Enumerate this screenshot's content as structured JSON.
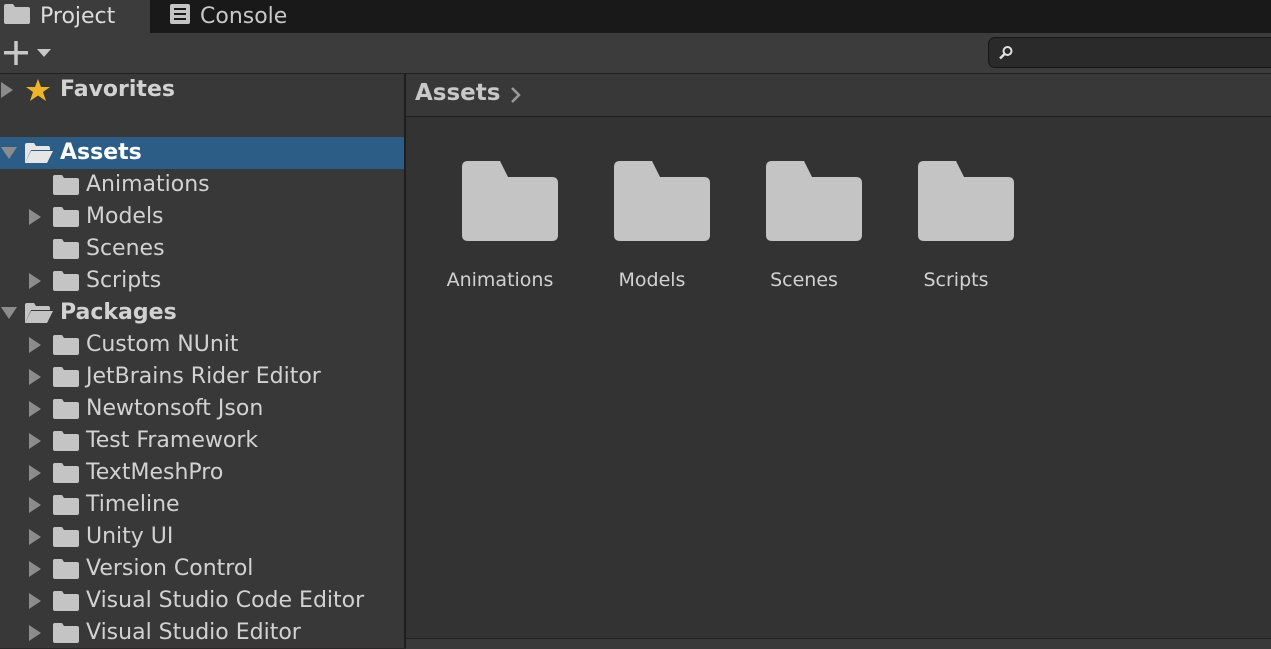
{
  "tabs": [
    {
      "label": "Project",
      "icon": "folder-icon",
      "active": true
    },
    {
      "label": "Console",
      "icon": "console-icon",
      "active": false
    }
  ],
  "toolbar": {
    "add_icon": "plus-icon",
    "search": {
      "value": "",
      "placeholder": ""
    }
  },
  "tree": {
    "favorites": {
      "label": "Favorites",
      "icon": "star-icon"
    },
    "assets": {
      "label": "Assets",
      "children": [
        "Animations",
        "Models",
        "Scenes",
        "Scripts"
      ]
    },
    "packages": {
      "label": "Packages",
      "children": [
        "Custom NUnit",
        "JetBrains Rider Editor",
        "Newtonsoft Json",
        "Test Framework",
        "TextMeshPro",
        "Timeline",
        "Unity UI",
        "Version Control",
        "Visual Studio Code Editor",
        "Visual Studio Editor"
      ]
    }
  },
  "breadcrumb": {
    "path": "Assets"
  },
  "content": {
    "items": [
      {
        "label": "Animations"
      },
      {
        "label": "Models"
      },
      {
        "label": "Scenes"
      },
      {
        "label": "Scripts"
      }
    ]
  },
  "colors": {
    "selection": "#2c5d87",
    "panel": "#383838",
    "content": "#333333",
    "folder": "#c4c4c4",
    "star": "#f0b429"
  }
}
